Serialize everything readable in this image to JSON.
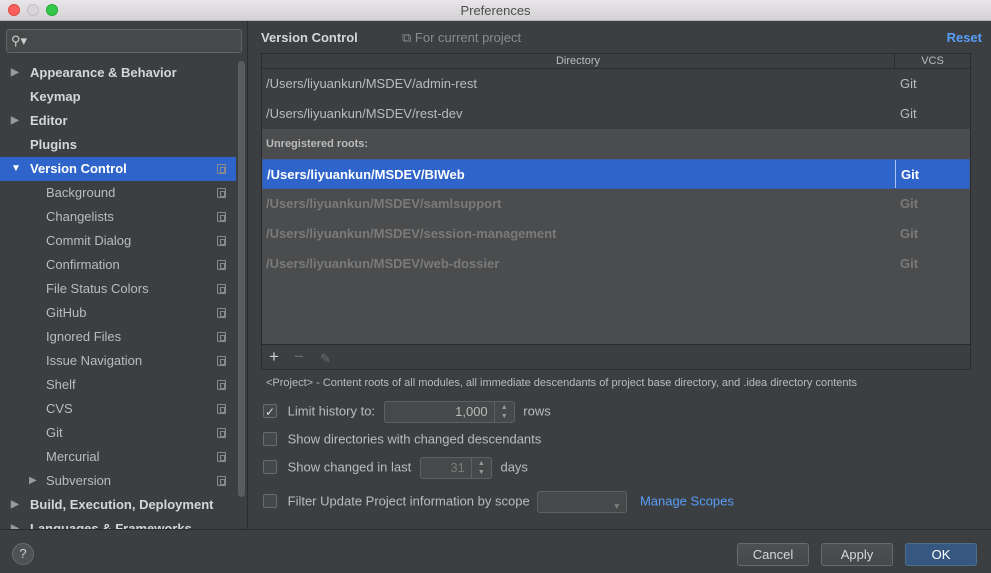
{
  "window": {
    "title": "Preferences"
  },
  "sidebar": {
    "search_placeholder": "",
    "items": [
      {
        "label": "Appearance & Behavior",
        "level": 0,
        "expandable": true
      },
      {
        "label": "Keymap",
        "level": 0
      },
      {
        "label": "Editor",
        "level": 0,
        "expandable": true
      },
      {
        "label": "Plugins",
        "level": 0
      },
      {
        "label": "Version Control",
        "level": 0,
        "expanded": true,
        "selected": true
      },
      {
        "label": "Background",
        "level": 1
      },
      {
        "label": "Changelists",
        "level": 1
      },
      {
        "label": "Commit Dialog",
        "level": 1
      },
      {
        "label": "Confirmation",
        "level": 1
      },
      {
        "label": "File Status Colors",
        "level": 1
      },
      {
        "label": "GitHub",
        "level": 1
      },
      {
        "label": "Ignored Files",
        "level": 1
      },
      {
        "label": "Issue Navigation",
        "level": 1
      },
      {
        "label": "Shelf",
        "level": 1
      },
      {
        "label": "CVS",
        "level": 1
      },
      {
        "label": "Git",
        "level": 1
      },
      {
        "label": "Mercurial",
        "level": 1
      },
      {
        "label": "Subversion",
        "level": 1,
        "expandable": true
      },
      {
        "label": "Build, Execution, Deployment",
        "level": 0,
        "expandable": true
      },
      {
        "label": "Languages & Frameworks",
        "level": 0,
        "expandable": true
      }
    ]
  },
  "panel": {
    "title": "Version Control",
    "scope_label": "For current project",
    "reset_label": "Reset",
    "table": {
      "headers": {
        "directory": "Directory",
        "vcs": "VCS"
      },
      "registered": [
        {
          "directory": "/Users/liyuankun/MSDEV/admin-rest",
          "vcs": "Git"
        },
        {
          "directory": "/Users/liyuankun/MSDEV/rest-dev",
          "vcs": "Git"
        }
      ],
      "unregistered_label": "Unregistered roots:",
      "unregistered": [
        {
          "directory": "/Users/liyuankun/MSDEV/BIWeb",
          "vcs": "Git"
        },
        {
          "directory": "/Users/liyuankun/MSDEV/samlsupport",
          "vcs": "Git"
        },
        {
          "directory": "/Users/liyuankun/MSDEV/session-management",
          "vcs": "Git"
        },
        {
          "directory": "/Users/liyuankun/MSDEV/web-dossier",
          "vcs": "Git"
        }
      ],
      "toolbar": {
        "add": "+",
        "remove": "−",
        "edit": "✎"
      }
    },
    "note": "<Project> - Content roots of all modules, all immediate descendants of project base directory, and .idea directory contents",
    "options": {
      "limit_history": {
        "label": "Limit history to:",
        "checked": true,
        "value": "1,000",
        "suffix": "rows"
      },
      "show_dirs": {
        "label": "Show directories with changed descendants",
        "checked": false
      },
      "show_changed": {
        "label": "Show changed in last",
        "checked": false,
        "value": "31",
        "suffix": "days"
      },
      "filter_update": {
        "label": "Filter Update Project information by scope",
        "checked": false,
        "combo_value": "",
        "link": "Manage Scopes"
      }
    }
  },
  "footer": {
    "help": "?",
    "cancel": "Cancel",
    "apply": "Apply",
    "ok": "OK"
  }
}
